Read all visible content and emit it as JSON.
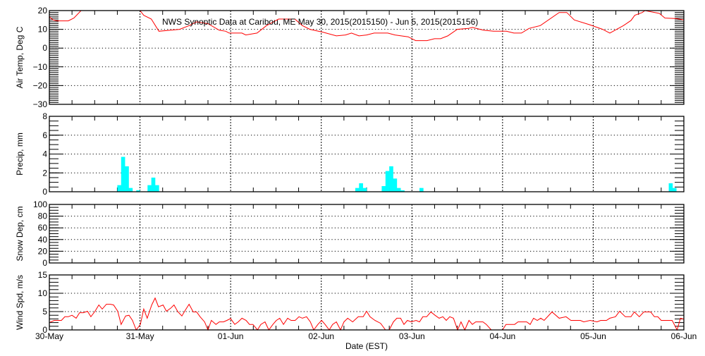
{
  "chart_data": [
    {
      "type": "line",
      "title": "NWS Synoptic Data at Caribou, ME   May 30, 2015(2015150) - Jun  5, 2015(2015156)",
      "ylabel": "Air Temp, Deg C",
      "ylim": [
        -30,
        20
      ],
      "yticks": [
        "20",
        "10",
        "0",
        "−10",
        "−20",
        "−30"
      ],
      "ytick_values": [
        20,
        10,
        0,
        -10,
        -20,
        -30
      ],
      "x_unit": "hours since 30-May 00:00 EST",
      "color": "#ff0000",
      "points": [
        [
          0,
          16.6
        ],
        [
          1,
          15
        ],
        [
          2,
          14.5
        ],
        [
          5,
          14.5
        ],
        [
          6.5,
          16
        ],
        [
          8.4,
          20
        ],
        [
          10,
          22
        ],
        [
          22,
          22
        ],
        [
          24,
          20
        ],
        [
          25,
          17.5
        ],
        [
          27,
          15.5
        ],
        [
          29,
          9
        ],
        [
          32,
          9.5
        ],
        [
          34.5,
          10
        ],
        [
          37,
          12
        ],
        [
          39,
          14
        ],
        [
          42,
          13
        ],
        [
          45,
          9.5
        ],
        [
          46.7,
          9
        ],
        [
          47.6,
          8
        ],
        [
          51,
          8
        ],
        [
          52,
          7
        ],
        [
          55,
          8
        ],
        [
          57.5,
          12
        ],
        [
          60.7,
          15.5
        ],
        [
          65,
          15.5
        ],
        [
          67,
          12
        ],
        [
          69,
          10
        ],
        [
          72.4,
          8.5
        ],
        [
          76,
          6.5
        ],
        [
          78.4,
          7
        ],
        [
          80,
          8
        ],
        [
          82,
          6.5
        ],
        [
          84,
          7
        ],
        [
          86,
          8
        ],
        [
          89.6,
          8
        ],
        [
          91.5,
          7
        ],
        [
          95,
          6
        ],
        [
          97,
          4
        ],
        [
          100,
          4
        ],
        [
          102,
          5
        ],
        [
          103.6,
          5
        ],
        [
          105.5,
          6.5
        ],
        [
          108,
          10
        ],
        [
          111,
          10.5
        ],
        [
          112,
          11
        ],
        [
          115,
          9.5
        ],
        [
          117.6,
          9
        ],
        [
          121,
          9
        ],
        [
          123,
          8
        ],
        [
          125,
          8
        ],
        [
          127,
          10.5
        ],
        [
          130,
          12
        ],
        [
          135,
          19
        ],
        [
          137,
          19
        ],
        [
          139,
          15
        ],
        [
          143,
          12.5
        ],
        [
          146.5,
          10
        ],
        [
          148.4,
          8
        ],
        [
          152,
          12
        ],
        [
          154,
          14.7
        ],
        [
          155,
          17.5
        ],
        [
          157,
          19
        ],
        [
          157.7,
          20
        ],
        [
          161.5,
          18.5
        ],
        [
          163,
          16
        ],
        [
          166,
          15.7
        ],
        [
          168,
          15
        ]
      ]
    },
    {
      "type": "bar",
      "ylabel": "Precip, mm",
      "ylim": [
        0,
        8
      ],
      "yticks": [
        "8",
        "6",
        "4",
        "2",
        "0"
      ],
      "ytick_values": [
        8,
        6,
        4,
        2,
        0
      ],
      "x_unit": "hour index since 30-May 00:00 EST",
      "color": "#00ffff",
      "bars": [
        [
          18,
          0.7
        ],
        [
          19,
          3.7
        ],
        [
          20,
          2.7
        ],
        [
          21,
          0.4
        ],
        [
          23,
          0.15
        ],
        [
          26,
          0.7
        ],
        [
          27,
          1.5
        ],
        [
          28,
          0.7
        ],
        [
          81,
          0.4
        ],
        [
          82,
          0.9
        ],
        [
          83,
          0.4
        ],
        [
          88,
          0.6
        ],
        [
          89,
          2.2
        ],
        [
          90,
          2.7
        ],
        [
          91,
          1.4
        ],
        [
          92,
          0.4
        ],
        [
          93,
          0.15
        ],
        [
          98,
          0.4
        ],
        [
          164,
          0.9
        ],
        [
          165,
          0.4
        ]
      ]
    },
    {
      "type": "line",
      "ylabel": "Snow Dep, cm",
      "ylim": [
        0,
        100
      ],
      "yticks": [
        "100",
        "80",
        "60",
        "40",
        "20",
        "0"
      ],
      "ytick_values": [
        100,
        80,
        60,
        40,
        20,
        0
      ],
      "points": []
    },
    {
      "type": "line",
      "ylabel": "Wind Spd, m/s",
      "ylim": [
        0,
        15
      ],
      "yticks": [
        "15",
        "10",
        "5",
        "0"
      ],
      "ytick_values": [
        15,
        10,
        5,
        0
      ],
      "x_unit": "hours since 30-May 00:00 EST",
      "color": "#ff0000",
      "points": [
        [
          0.2,
          2.1
        ],
        [
          1.3,
          2.6
        ],
        [
          3.2,
          2.6
        ],
        [
          4.1,
          3.6
        ],
        [
          5,
          3.6
        ],
        [
          6,
          4
        ],
        [
          7.1,
          3.2
        ],
        [
          8,
          4.7
        ],
        [
          9,
          4.7
        ],
        [
          10.1,
          5.1
        ],
        [
          11,
          3.6
        ],
        [
          12.1,
          5.1
        ],
        [
          13.1,
          6.8
        ],
        [
          14,
          5.7
        ],
        [
          15.1,
          7
        ],
        [
          16.2,
          7
        ],
        [
          17,
          6.8
        ],
        [
          18.1,
          5.1
        ],
        [
          19,
          1.5
        ],
        [
          20.2,
          3.8
        ],
        [
          21.1,
          4
        ],
        [
          22,
          2.6
        ],
        [
          23,
          0
        ],
        [
          24.1,
          1.5
        ],
        [
          25,
          5.7
        ],
        [
          25.9,
          3.2
        ],
        [
          27.1,
          6.8
        ],
        [
          28,
          8.7
        ],
        [
          28.9,
          6.3
        ],
        [
          30.1,
          6.8
        ],
        [
          31,
          5.1
        ],
        [
          32.1,
          5.9
        ],
        [
          33,
          6.8
        ],
        [
          34,
          5
        ],
        [
          35.1,
          3.8
        ],
        [
          36,
          5.4
        ],
        [
          37,
          7
        ],
        [
          38.1,
          4.9
        ],
        [
          39,
          4.9
        ],
        [
          39.9,
          3.6
        ],
        [
          41.1,
          2.2
        ],
        [
          42,
          0
        ],
        [
          42.9,
          2.6
        ],
        [
          44.1,
          1.5
        ],
        [
          45,
          2.2
        ],
        [
          46.1,
          2.2
        ],
        [
          47,
          2.6
        ],
        [
          48,
          3.1
        ],
        [
          49.1,
          1.5
        ],
        [
          50,
          2.2
        ],
        [
          51,
          3.2
        ],
        [
          52.1,
          2.6
        ],
        [
          53,
          1.5
        ],
        [
          53.9,
          1.5
        ],
        [
          55.1,
          0
        ],
        [
          56,
          1.5
        ],
        [
          57.1,
          2.2
        ],
        [
          58.1,
          0
        ],
        [
          59.2,
          1.5
        ],
        [
          60.1,
          2.6
        ],
        [
          61,
          3.2
        ],
        [
          62,
          1.5
        ],
        [
          63.1,
          3.2
        ],
        [
          64,
          2.6
        ],
        [
          65.1,
          2.6
        ],
        [
          66.1,
          3.6
        ],
        [
          67,
          3.2
        ],
        [
          68.1,
          3.6
        ],
        [
          69.1,
          2.2
        ],
        [
          70,
          0
        ],
        [
          71.1,
          1.5
        ],
        [
          72.1,
          2.6
        ],
        [
          73,
          1.5
        ],
        [
          74.1,
          0
        ],
        [
          75,
          1.5
        ],
        [
          76,
          2.2
        ],
        [
          77.1,
          0
        ],
        [
          78,
          2.2
        ],
        [
          79,
          3.2
        ],
        [
          80.3,
          2.2
        ],
        [
          81.8,
          3.6
        ],
        [
          83.1,
          3.6
        ],
        [
          84,
          5.1
        ],
        [
          84.9,
          3.6
        ],
        [
          86.2,
          2.6
        ],
        [
          87.7,
          1.8
        ],
        [
          89,
          0
        ],
        [
          90,
          0
        ],
        [
          91.1,
          2.2
        ],
        [
          92,
          3.2
        ],
        [
          93,
          3.2
        ],
        [
          93.9,
          1.5
        ],
        [
          94.8,
          2.6
        ],
        [
          95.8,
          2.2
        ],
        [
          97.1,
          2.6
        ],
        [
          98,
          2.2
        ],
        [
          98.9,
          3.6
        ],
        [
          99.9,
          3.6
        ],
        [
          101,
          4.9
        ],
        [
          102.1,
          4
        ],
        [
          103.2,
          3.2
        ],
        [
          104.2,
          3.6
        ],
        [
          105.1,
          2.6
        ],
        [
          106,
          3.6
        ],
        [
          107,
          3.2
        ],
        [
          108.1,
          0
        ],
        [
          109,
          2.2
        ],
        [
          110,
          0
        ],
        [
          111.1,
          2.6
        ],
        [
          112,
          1.5
        ],
        [
          112.9,
          2.2
        ],
        [
          114.8,
          2.2
        ],
        [
          115.7,
          1.5
        ],
        [
          117,
          0
        ],
        [
          120,
          0
        ],
        [
          120.9,
          1.5
        ],
        [
          123.2,
          1.5
        ],
        [
          124.1,
          2.2
        ],
        [
          126.4,
          2.2
        ],
        [
          127.3,
          1.5
        ],
        [
          128.2,
          3.2
        ],
        [
          129.2,
          2.6
        ],
        [
          130.1,
          3.2
        ],
        [
          131,
          2.6
        ],
        [
          133.1,
          4.9
        ],
        [
          135,
          3.2
        ],
        [
          136.8,
          3.6
        ],
        [
          138.1,
          2.6
        ],
        [
          140.6,
          2.6
        ],
        [
          141.5,
          2.2
        ],
        [
          143.2,
          2.6
        ],
        [
          145,
          2.2
        ],
        [
          146,
          2.6
        ],
        [
          147.5,
          2.6
        ],
        [
          148.4,
          3.2
        ],
        [
          149.9,
          3.6
        ],
        [
          151,
          5.1
        ],
        [
          152.5,
          3.6
        ],
        [
          154,
          3.6
        ],
        [
          154.9,
          4.9
        ],
        [
          156.2,
          3.6
        ],
        [
          157.4,
          4.9
        ],
        [
          159.2,
          4.9
        ],
        [
          160.2,
          3.6
        ],
        [
          161.1,
          3.6
        ],
        [
          162,
          2.6
        ],
        [
          164.9,
          2.6
        ],
        [
          166.2,
          0
        ],
        [
          167.1,
          3.2
        ],
        [
          168,
          2.9
        ]
      ]
    }
  ],
  "x_axis": {
    "label": "Date (EST)",
    "range_hours": [
      0,
      168
    ],
    "ticks": [
      "30-May",
      "31-May",
      "01-Jun",
      "02-Jun",
      "03-Jun",
      "04-Jun",
      "05-Jun",
      "06-Jun"
    ]
  }
}
